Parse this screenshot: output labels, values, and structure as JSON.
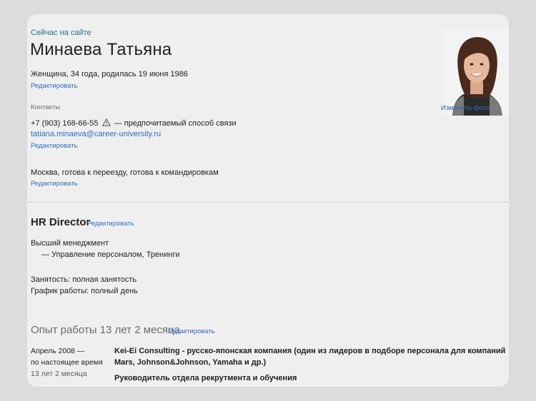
{
  "profile": {
    "status": "Сейчас на сайте",
    "name": "Минаева Татьяна",
    "personal_info": "Женщина, 34 года, родилась 19 июня 1986",
    "edit_label": "Редактировать",
    "change_photo": "Изменить фото"
  },
  "contacts": {
    "heading": "Контакты",
    "phone": "+7 (903) 168-66-55",
    "phone_note": "— предпочитаемый способ связи",
    "email": "tatiana.minaeva@career-university.ru",
    "location": "Москва, готова к переезду, готова к командировкам"
  },
  "position": {
    "title": "HR Director",
    "category": "Высший менеджмент",
    "specialization": "— Управление персоналом, Тренинги",
    "employment": "Занятость: полная занятость",
    "schedule": "График работы: полный день"
  },
  "experience": {
    "title": "Опыт работы 13 лет 2 месяца",
    "items": [
      {
        "start": "Апрель 2008 —",
        "end": "по настоящее время",
        "duration": "13 лет 2 месяца",
        "company": "Kei-Ei Consulting - русско-японская компания (один из лидеров в подборе персонала для компаний Mars, Johnson&Johnson, Yamaha и др.)",
        "role": "Руководитель отдела рекрутмента и обучения"
      }
    ]
  },
  "icons": {
    "phone_warning": "warning-triangle-icon",
    "photo": "profile-photo"
  },
  "colors": {
    "link": "#2d6dbb",
    "status": "#2a6e8a",
    "card": "#efeff0",
    "background": "#dcdcdd"
  }
}
